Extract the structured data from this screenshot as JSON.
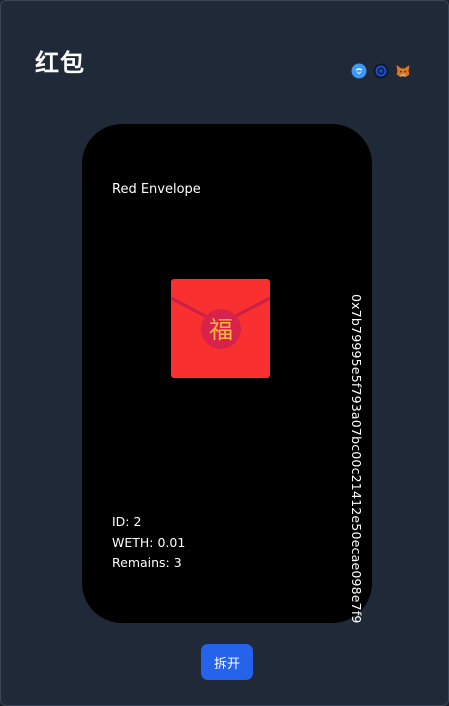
{
  "header": {
    "title": "红包",
    "wallet_icons": [
      "walletconnect-icon",
      "coinbase-wallet-icon",
      "metamask-fox-icon"
    ]
  },
  "card": {
    "label": "Red Envelope",
    "envelope_character": "福",
    "address": "0x7b79995e5f793a07bc00c21412e50ecae098e7f9",
    "id_text": "ID: 2",
    "amount_text": "WETH: 0.01",
    "remains_text": "Remains: 3"
  },
  "actions": {
    "open_label": "拆开"
  },
  "colors": {
    "background": "#1f2937",
    "card": "#000000",
    "envelope_red": "#f8302f",
    "seal": "#e02a3e",
    "accent": "#2563eb"
  }
}
